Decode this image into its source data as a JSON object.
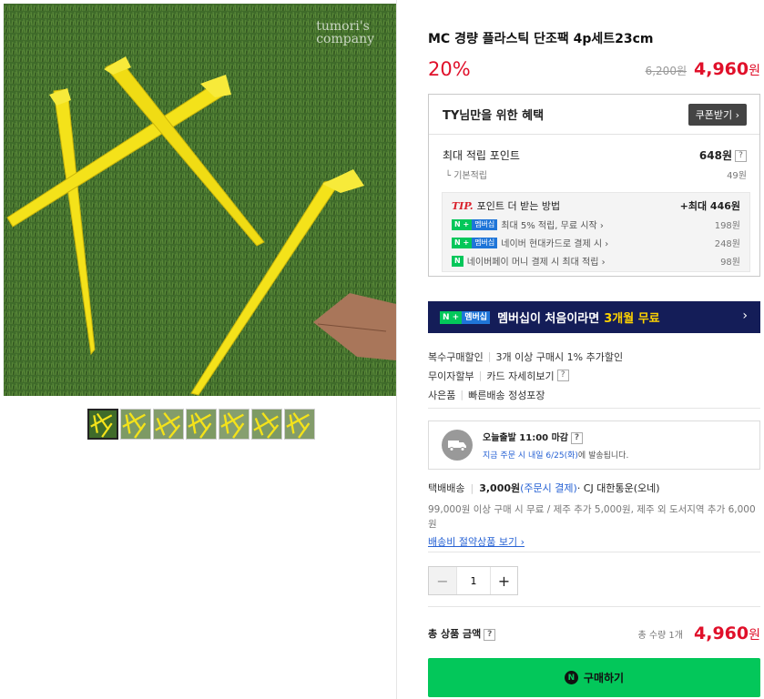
{
  "product": {
    "title": "MC 경량 플라스틱 단조팩 4p세트23cm",
    "discount": "20%",
    "original_price": "6,200원",
    "sale_price": "4,960",
    "won": "원",
    "watermark_line1": "tumori's",
    "watermark_line2": "company"
  },
  "benefit": {
    "title": "TY님만을 위한 혜택",
    "coupon_button": "쿠폰받기 ›",
    "max_point_label": "최대 적립 포인트",
    "max_point_value": "648원",
    "base_label": "기본적립",
    "base_value": "49원",
    "tip_word": "TIP.",
    "tip_title": "포인트 더 받는 방법",
    "tip_max": "+최대 446원",
    "items": [
      {
        "badge_n": "N +",
        "badge_m": "멤버십",
        "label": "최대 5% 적립, 무료 시작 ›",
        "amount": "198원"
      },
      {
        "badge_n": "N +",
        "badge_m": "멤버십",
        "label": "네이버 현대카드로 결제 시 ›",
        "amount": "248원"
      },
      {
        "badge_n": "N",
        "badge_m": "",
        "label": "네이버페이 머니 결제 시 최대 적립 ›",
        "amount": "98원"
      }
    ]
  },
  "banner": {
    "badge_n": "N +",
    "badge_m": "멤버십",
    "text": "멤버십이 처음이라면",
    "highlight": "3개월 무료",
    "arrow": "›"
  },
  "info": {
    "bulk_label": "복수구매할인",
    "bulk_value": "3개 이상 구매시 1% 추가할인",
    "installment_label": "무이자할부",
    "installment_value": "카드 자세히보기",
    "gift_label": "사은품",
    "gift_value": "빠른배송 정성포장"
  },
  "shipping": {
    "title": "오늘출발 11:00 마감",
    "sub_highlight": "지금 주문 시 내일 6/25(화)",
    "sub_rest": "에 발송됩니다."
  },
  "delivery": {
    "label": "택배배송",
    "fee": "3,000원",
    "fee_note": "(주문시 결제)",
    "carrier": "· CJ 대한통운(오네)",
    "note": "99,000원 이상 구매 시 무료 / 제주 추가 5,000원, 제주 외 도서지역 추가 6,000원",
    "save_link": "배송비 절약상품 보기 ›"
  },
  "quantity": {
    "minus": "−",
    "value": "1",
    "plus": "+"
  },
  "total": {
    "label": "총 상품 금액",
    "qty": "총 수량 1개",
    "price": "4,960",
    "won": "원"
  },
  "buy": {
    "icon": "N",
    "label": "구매하기"
  },
  "colors": {
    "accent_red": "#e0102a",
    "naver_green": "#03c75a",
    "banner_navy": "#141d58",
    "link_blue": "#2762d4"
  }
}
